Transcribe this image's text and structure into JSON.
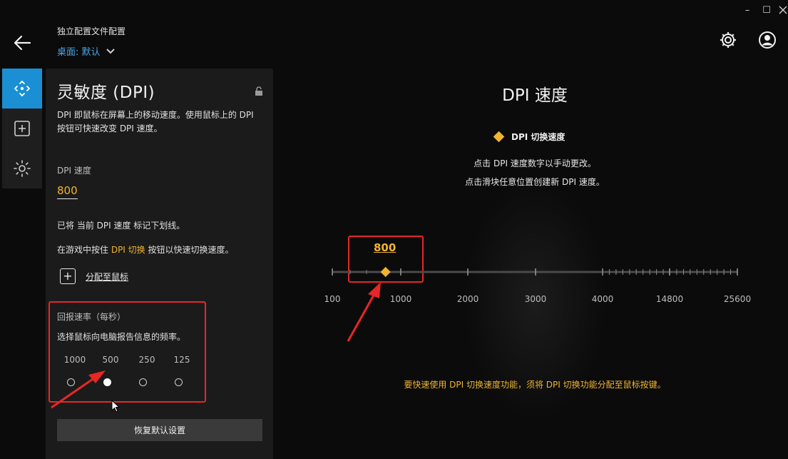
{
  "window": {
    "minimize": "–",
    "maximize": "☐"
  },
  "header": {
    "profile_title": "独立配置文件配置",
    "profile_value": "桌面: 默认",
    "icons": [
      "back-arrow-icon",
      "gear-icon",
      "user-account-icon",
      "chevron-down-icon"
    ]
  },
  "rail": {
    "items": [
      "move-icon",
      "add-square-icon",
      "brightness-icon"
    ],
    "active_index": 0
  },
  "panel": {
    "title": "灵敏度 (DPI)",
    "description": "DPI 即鼠标在屏幕上的移动速度。使用鼠标上的 DPI 按钮可快速改变 DPI 速度。",
    "dpi_label": "DPI 速度",
    "dpi_value": "800",
    "note1": "已将 当前 DPI 速度 标记下划线。",
    "note2_pre": "在游戏中按住 ",
    "note2_hl": "DPI 切换",
    "note2_post": " 按钮以快速切换速度。",
    "assign_label": "分配至鼠标",
    "report_rate_title": "回报速率（每秒）",
    "report_rate_desc": "选择鼠标向电脑报告信息的频率。",
    "report_rates": [
      "1000",
      "500",
      "250",
      "125"
    ],
    "report_rate_selected": "500",
    "reset_label": "恢复默认设置"
  },
  "dpi_chart": {
    "title": "DPI 速度",
    "legend_label": "DPI 切换速度",
    "hint1": "点击 DPI 速度数字以手动更改。",
    "hint2": "点击滑块任意位置创建新 DPI 速度。",
    "current_dpi": "800",
    "tick_labels": [
      "100",
      "1000",
      "2000",
      "3000",
      "4000",
      "14800",
      "25600"
    ],
    "bottom_hint": "要快速使用 DPI 切换速度功能，须将 DPI 切换功能分配至鼠标按键。",
    "colors": {
      "accent": "#f0b430",
      "annotation": "#e82626",
      "active": "#1a8fd4"
    }
  }
}
